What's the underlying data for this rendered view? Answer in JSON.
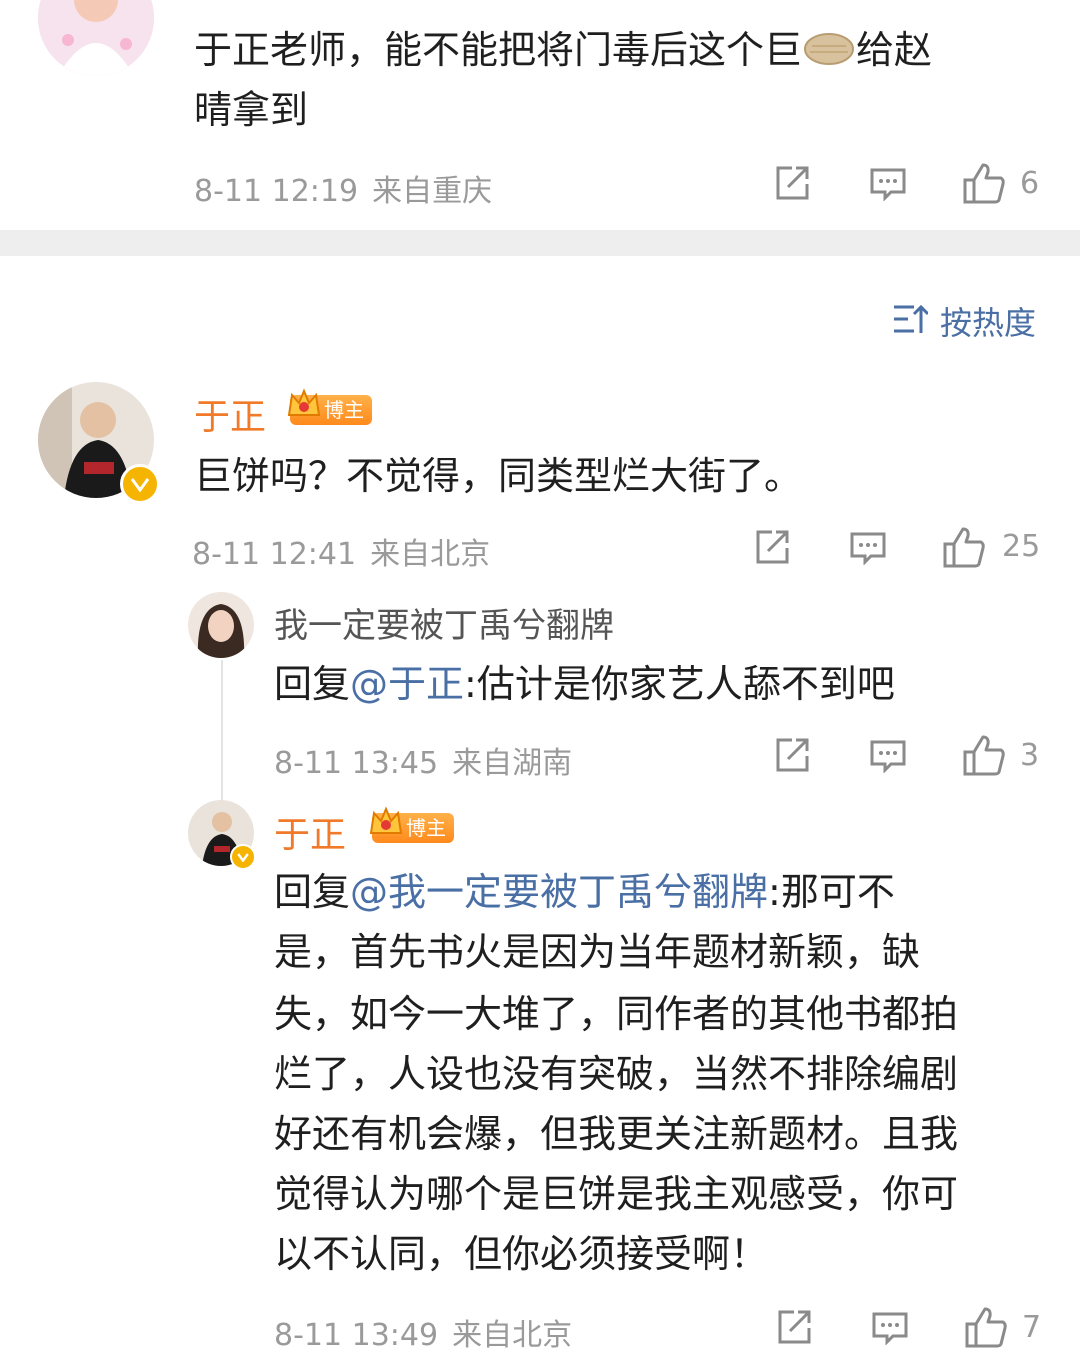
{
  "comment_top": {
    "text_line1": "于正老师，能不能把将门毒后这个巨",
    "emoji_name": "pie-emoji",
    "text_line1_tail": "给赵",
    "text_line2": "晴拿到",
    "time": "8-11 12:19",
    "location": "来自重庆",
    "likes": "6"
  },
  "sort": {
    "label": "按热度"
  },
  "comment_main": {
    "username": "于正",
    "badge": "博主",
    "text": "巨饼吗？不觉得，同类型烂大街了。",
    "time": "8-11 12:41",
    "location": "来自北京",
    "likes": "25"
  },
  "reply_1": {
    "username": "我一定要被丁禹兮翻牌",
    "prefix": "回复",
    "mention": "@于正",
    "text": ":估计是你家艺人舔不到吧",
    "time": "8-11 13:45",
    "location": "来自湖南",
    "likes": "3"
  },
  "reply_2": {
    "username": "于正",
    "badge": "博主",
    "prefix": "回复",
    "mention": "@我一定要被丁禹兮翻牌",
    "line1_tail": ":那可不",
    "lines": [
      "是，首先书火是因为当年题材新颖，缺",
      "失，如今一大堆了，同作者的其他书都拍",
      "烂了，人设也没有突破，当然不排除编剧",
      "好还有机会爆，但我更关注新题材。且我",
      "觉得认为哪个是巨饼是我主观感受，你可",
      "以不认同，但你必须接受啊！"
    ],
    "time": "8-11 13:49",
    "location": "来自北京",
    "likes": "7"
  }
}
